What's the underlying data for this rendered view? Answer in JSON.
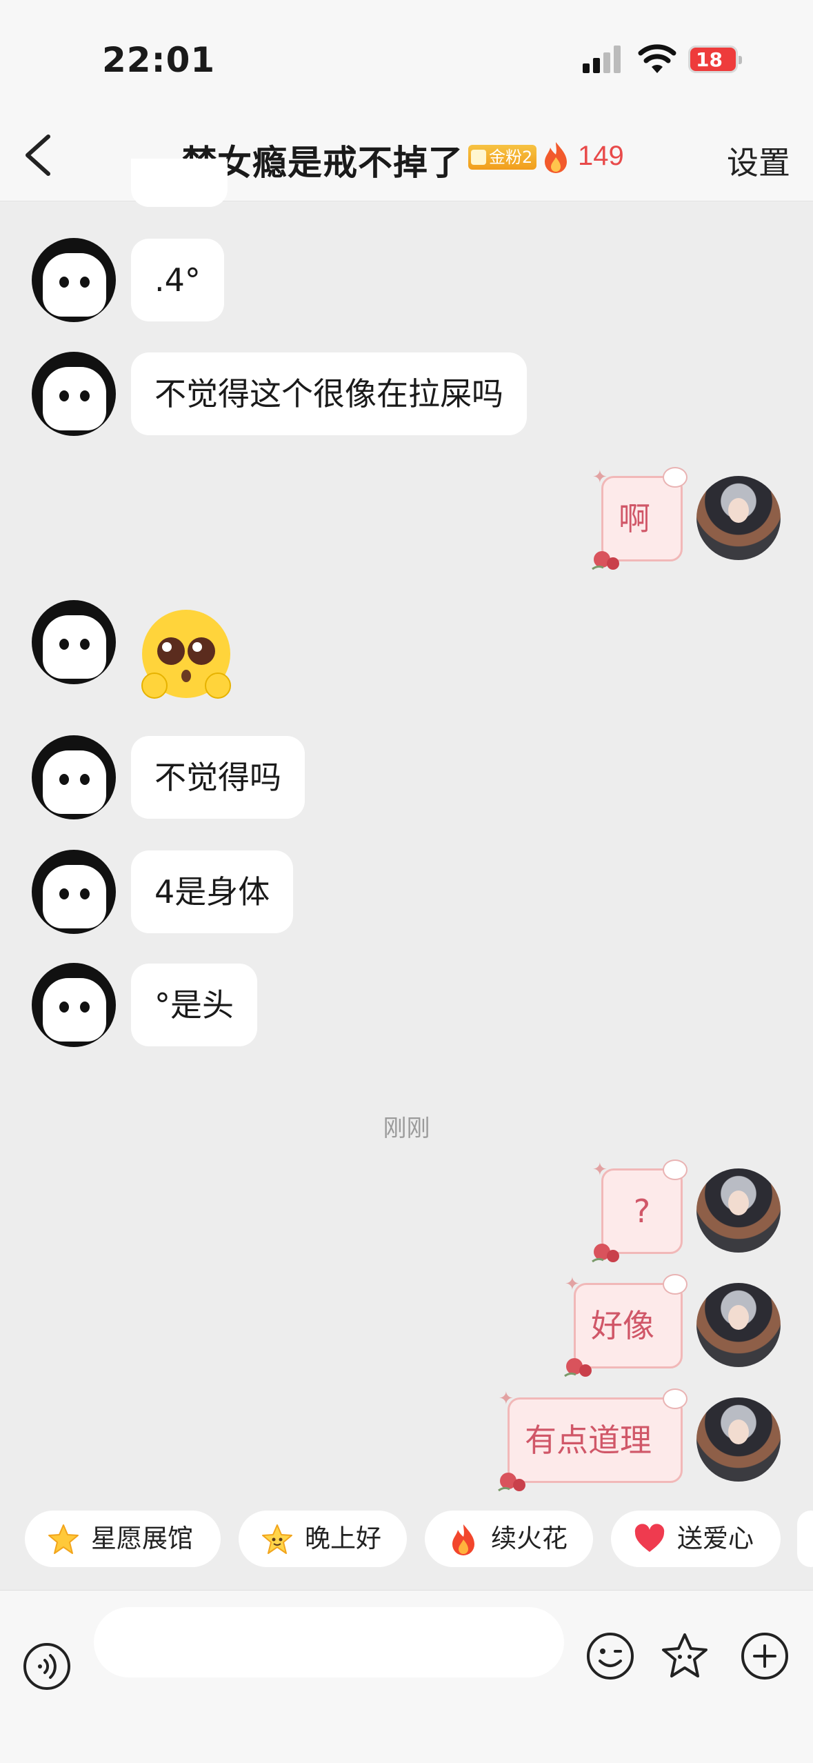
{
  "status_bar": {
    "time": "22:01",
    "battery": "18"
  },
  "header": {
    "back_icon": "chevron-left-icon",
    "title": "梦女瘾是戒不掉了",
    "fan_badge": "金粉2",
    "fire_count": "149",
    "settings_label": "设置"
  },
  "messages": [
    {
      "side": "left",
      "text": ".4°"
    },
    {
      "side": "left",
      "text": "不觉得这个很像在拉屎吗"
    },
    {
      "side": "right",
      "text": "啊"
    },
    {
      "side": "left",
      "emoji": "pleading-face-icon"
    },
    {
      "side": "left",
      "text": "不觉得吗"
    },
    {
      "side": "left",
      "text": "4是身体"
    },
    {
      "side": "left",
      "text": "°是头"
    },
    {
      "side": "right",
      "text": "?"
    },
    {
      "side": "right",
      "text": "好像"
    },
    {
      "side": "right",
      "text": "有点道理"
    }
  ],
  "time_divider": "刚刚",
  "quick_actions": [
    {
      "label": "星愿展馆",
      "icon": "star-icon"
    },
    {
      "label": "晚上好",
      "icon": "smiling-star-icon"
    },
    {
      "label": "续火花",
      "icon": "fire-icon"
    },
    {
      "label": "送爱心",
      "icon": "heart-icon"
    }
  ],
  "input_bar": {
    "placeholder": ""
  },
  "colors": {
    "fire": "#e84a4a",
    "bubble_bg": "#ffffff",
    "chat_bg": "#ededed",
    "sticker_text": "#d05768"
  }
}
